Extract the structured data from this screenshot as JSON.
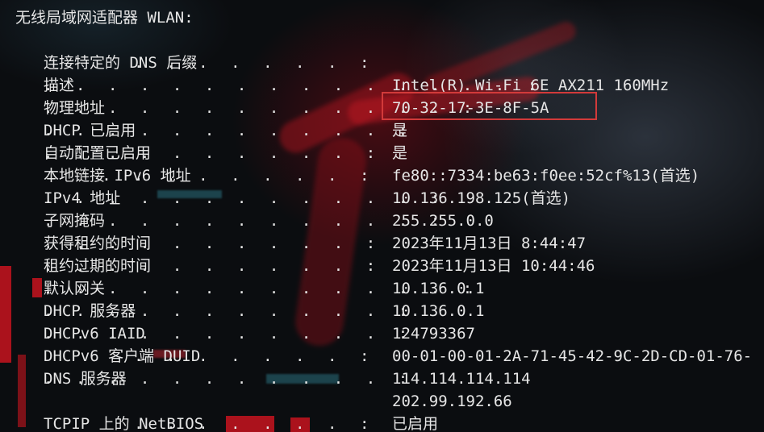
{
  "header": "无线局域网适配器 WLAN:",
  "rows": [
    {
      "label": "连接特定的 DNS 后缀",
      "dots": ". . . . . . . :",
      "value": ""
    },
    {
      "label": "描述",
      "dots": ". . . . . . . . . . . . . . . :",
      "value": "Intel(R) Wi-Fi 6E AX211 160MHz"
    },
    {
      "label": "物理地址",
      "dots": ". . . . . . . . . . . . . :",
      "value": "70-32-17-3E-8F-5A"
    },
    {
      "label": "DHCP 已启用",
      "dots": ". . . . . . . . . . . :",
      "value": "是"
    },
    {
      "label": "自动配置已启用",
      "dots": ". . . . . . . . . . :",
      "value": "是"
    },
    {
      "label": "本地链接 IPv6 地址",
      "dots": ". . . . . . . . :",
      "value": "fe80::7334:be63:f0ee:52cf%13(首选)"
    },
    {
      "label": "IPv4 地址",
      "dots": ". . . . . . . . . . . . :",
      "value": "10.136.198.125(首选)"
    },
    {
      "label": "子网掩码",
      "dots": ". . . . . . . . . . . . :",
      "value": "255.255.0.0"
    },
    {
      "label": "获得租约的时间",
      "dots": ". . . . . . . . . . :",
      "value": "2023年11月13日 8:44:47"
    },
    {
      "label": "租约过期的时间",
      "dots": ". . . . . . . . . . :",
      "value": "2023年11月13日 10:44:46"
    },
    {
      "label": "默认网关",
      "dots": ". . . . . . . . . . . . . :",
      "value": "10.136.0.1"
    },
    {
      "label": "DHCP 服务器",
      "dots": ". . . . . . . . . . . :",
      "value": "10.136.0.1"
    },
    {
      "label": "DHCPv6 IAID",
      "dots": ". . . . . . . . . . . :",
      "value": "124793367"
    },
    {
      "label": "DHCPv6 客户端 DUID",
      "dots": ". . . . . . . :",
      "value": "00-01-00-01-2A-71-45-42-9C-2D-CD-01-76-"
    },
    {
      "label": "DNS 服务器",
      "dots": ". . . . . . . . . . . :",
      "value": "114.114.114.114"
    },
    {
      "label": "",
      "dots": "",
      "value": "202.99.192.66"
    },
    {
      "label": "TCPIP 上的 NetBIOS",
      "dots": ". . . . . . . :",
      "value": "已启用"
    }
  ],
  "colors": {
    "text": "#e6e6e6",
    "highlight_border": "#d23a3a",
    "background": "#0b0d10"
  }
}
